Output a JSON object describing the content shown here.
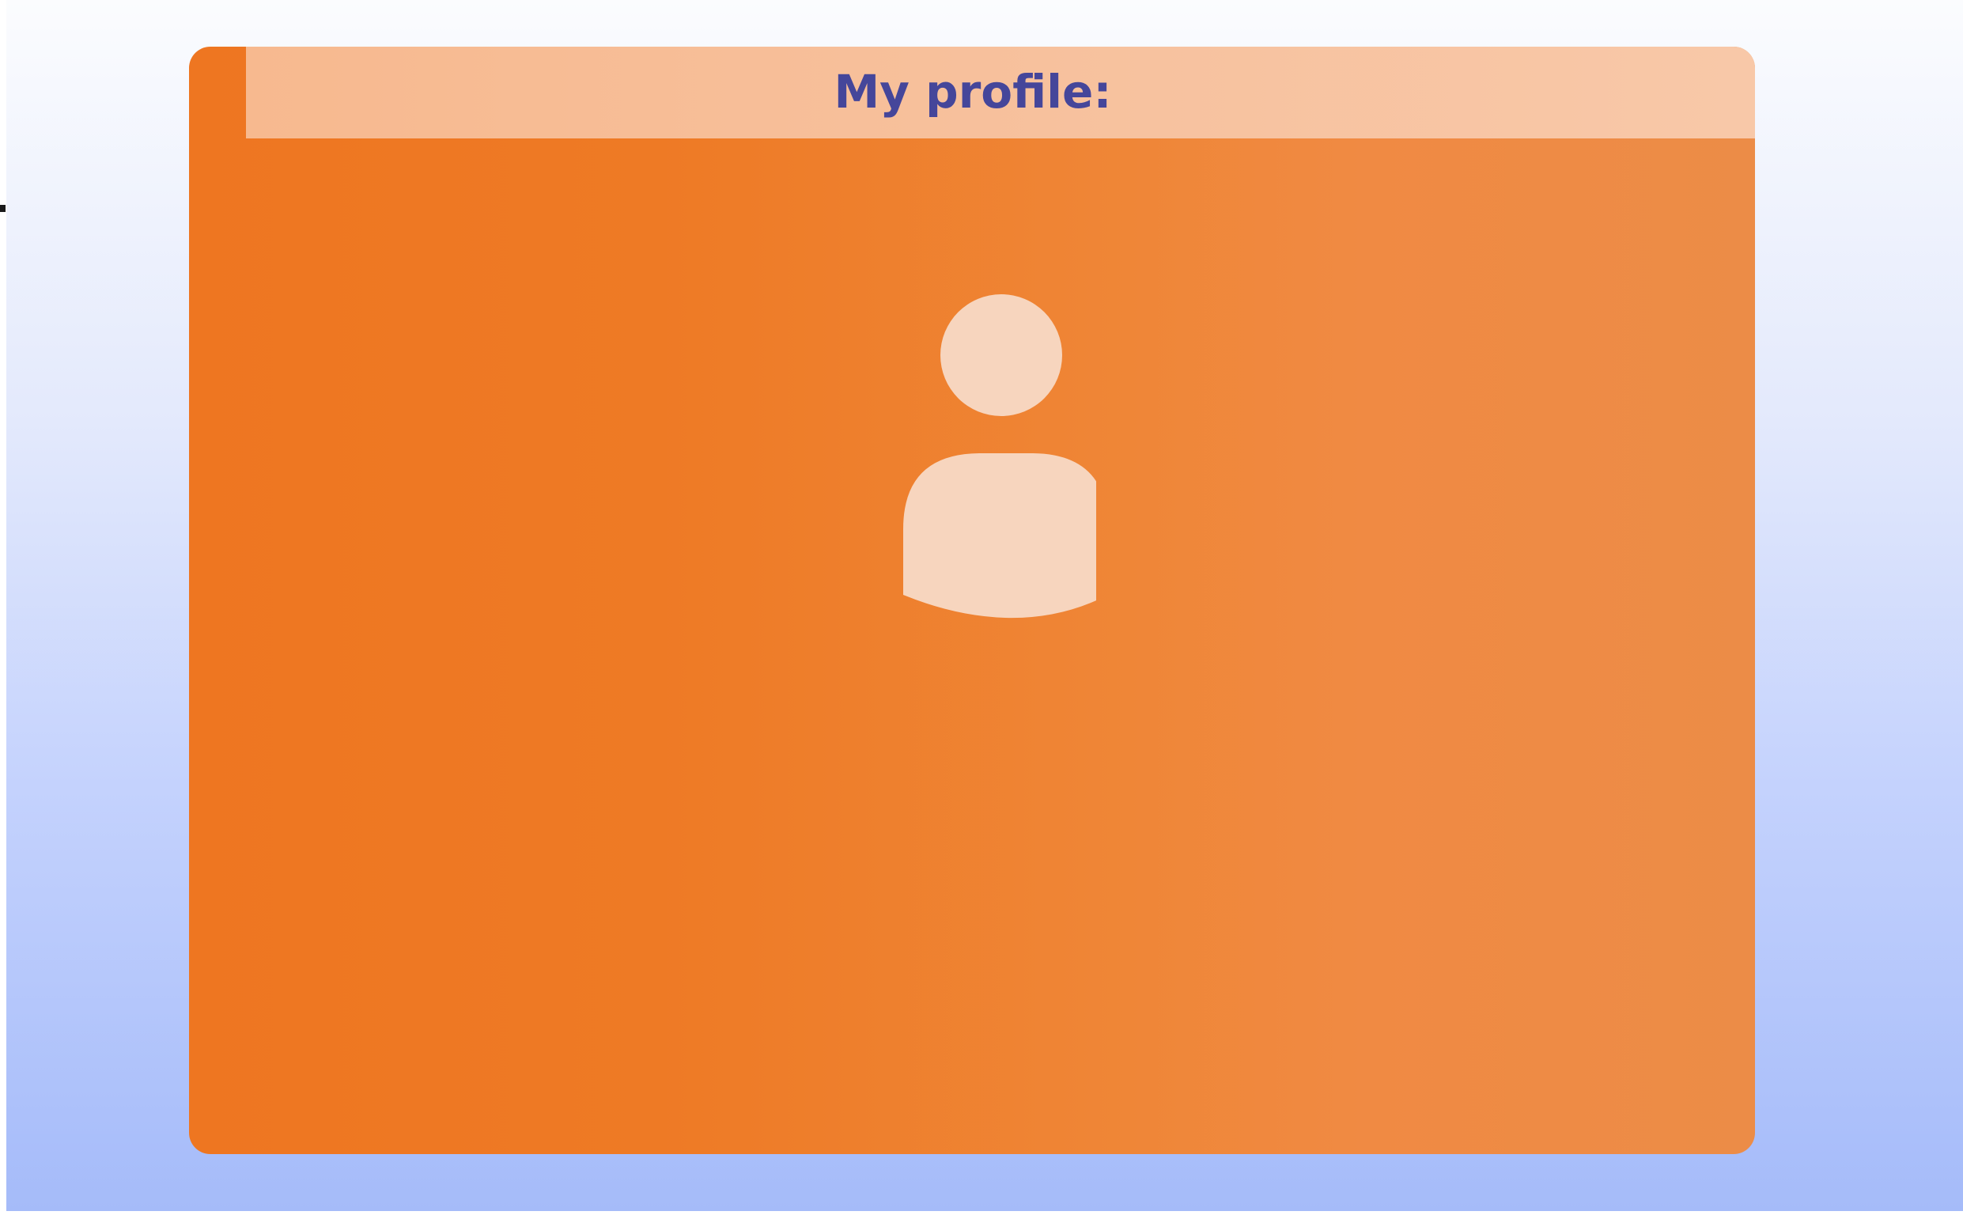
{
  "profile": {
    "title": "My profile:",
    "avatar_icon": "user-silhouette-icon"
  },
  "colors": {
    "card": "#ee7621",
    "header": "#f7c29f",
    "title_text": "#45469a",
    "avatar": "#f7d5be",
    "background_top": "#fbfcfe",
    "background_bottom": "#a5bbf9"
  }
}
